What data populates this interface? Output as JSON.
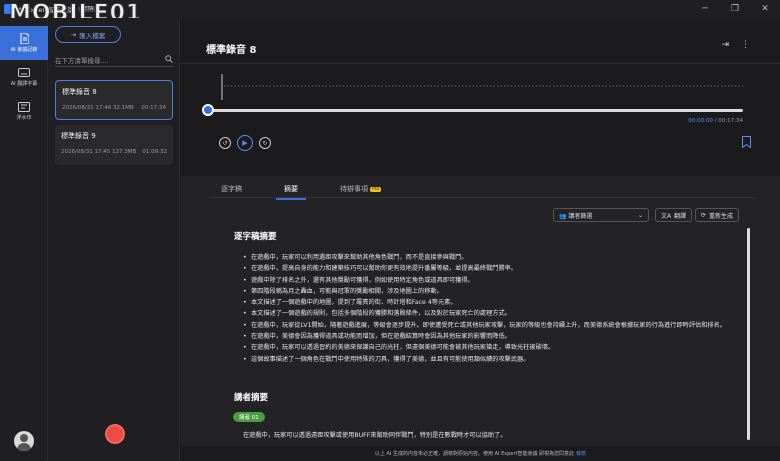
{
  "window": {
    "title": "AI Expert智能會議",
    "badge": "BETA",
    "watermark": "MOBILE01"
  },
  "rail": {
    "items": [
      {
        "label": "AI 會議記錄",
        "icon": "document-icon"
      },
      {
        "label": "AI 翻譯字幕",
        "icon": "subtitle-icon"
      },
      {
        "label": "浮水印",
        "icon": "watermark-icon"
      }
    ]
  },
  "list": {
    "import_label": "匯入檔案",
    "search_placeholder": "在下方清單搜尋....",
    "records": [
      {
        "title": "標準錄音 8",
        "datetime": "2026/08/31 17:46",
        "size": "32.1MB",
        "duration": "00:17:34"
      },
      {
        "title": "標準錄音 9",
        "datetime": "2026/08/31 17:45",
        "size": "127.3MB",
        "duration": "01:09:32"
      }
    ]
  },
  "main": {
    "title": "標準錄音 8",
    "player": {
      "current": "00:00:00",
      "separator": "/",
      "total": "00:17:34",
      "progress": 0
    }
  },
  "tabs": [
    {
      "label": "逐字稿"
    },
    {
      "label": "摘要"
    },
    {
      "label": "待辦事項",
      "badge": "Pro"
    }
  ],
  "toolbar": {
    "speaker_select": "講者篩選",
    "translate": "翻譯",
    "regenerate": "重新生成"
  },
  "summary": {
    "title": "逐字稿摘要",
    "bullets": [
      "在遊戲中，玩家可以利用遺距攻擊來幫助其他角色戰鬥，而不是直接參與戰鬥。",
      "在遊戲中，提高自身的能力和建築技巧可以幫助你更有效地提升番屬等級，並提高最終戰鬥勝率。",
      "遊戲中除了排名之外，還有其他獎勵可獲得，例如使用特定角色或道具即可獲得。",
      "第四階段稱為月之轟血，可能與冠軍的獎勵相關，涉及地圖上的移動。",
      "本文描述了一個遊戲中的地圖，提到了羅賓的街、時計塔和Face 4等元素。",
      "本文描述了一個遊戲的規則，包括多個階段的獲勝和落敗條件，以及對於玩家死亡的處理方式。",
      "在遊戲中，玩家從LV1開始，隨著遊戲進展，等級會逐步提升。即使遭受死亡或其他玩家攻擊，玩家的等級也會持續上升，而美德系統會根據玩家的行為進行即時評估和排名。",
      "在遊戲中，美德會因為獲得道具或功能而增加，但在遊戲結算時會因為其他玩家的影響而降低。",
      "在遊戲中，玩家可以透過習約的美德來保護自己的光柱，但遠個美德可能會被其他玩家搶走，導致光柱被破壞。",
      "這個故事描述了一個角色在戰鬥中使用特殊的刀具，獲得了美德，並且有可能使用類似績的攻擊武器。"
    ]
  },
  "speaker_summary": {
    "title": "講者摘要",
    "tag": "講者 01",
    "partial_text": "在遊戲中，玩家可以透過遠距攻擊或使用BUFF來幫助同伴戰鬥，特別是在數戰時才可以協助了。"
  },
  "footer": {
    "text": "以上 AI 生成的內容未必正確，請核對原始內容。使用 AI Expert智能會議 即視為您同意此",
    "link": "條款"
  }
}
